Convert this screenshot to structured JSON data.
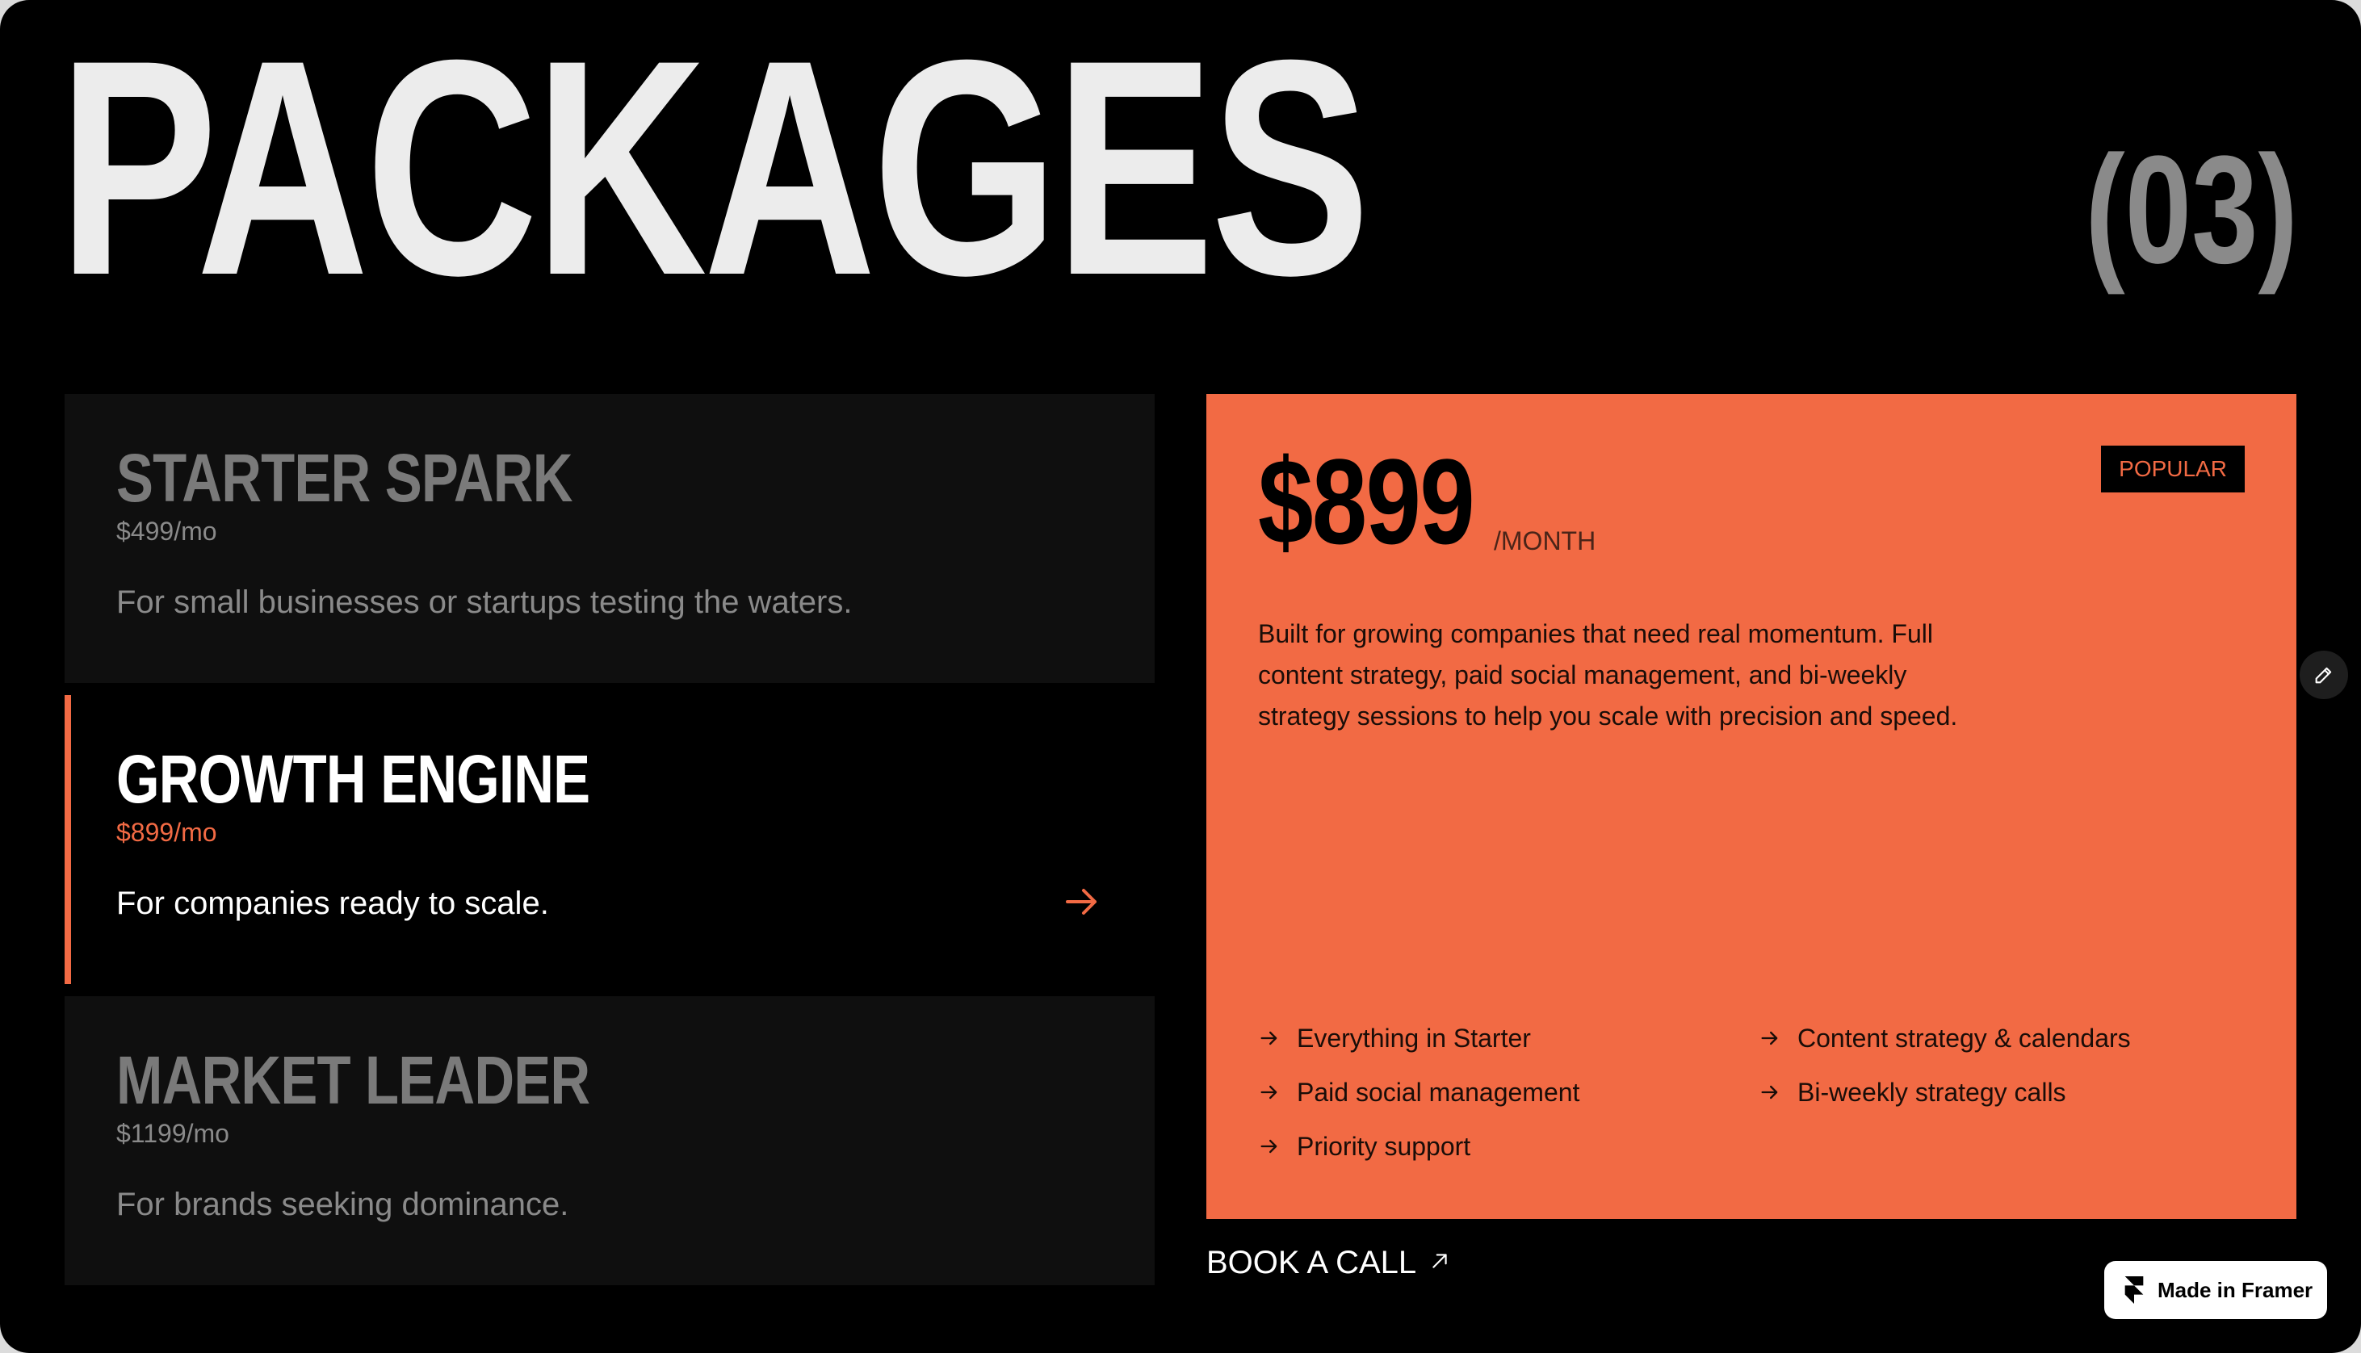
{
  "header": {
    "title": "PACKAGES",
    "section_number": "(03)"
  },
  "plans": [
    {
      "name": "STARTER SPARK",
      "price": "$499/mo",
      "description": "For small businesses or startups testing the waters.",
      "active": false
    },
    {
      "name": "GROWTH ENGINE",
      "price": "$899/mo",
      "description": "For companies ready to scale.",
      "active": true
    },
    {
      "name": "MARKET LEADER",
      "price": "$1199/mo",
      "description": "For brands seeking dominance.",
      "active": false
    }
  ],
  "detail": {
    "badge": "POPULAR",
    "price": "$899",
    "period": "/MONTH",
    "description": "Built for growing companies that need real momentum. Full content strategy, paid social management, and bi-weekly strategy sessions to help you scale with precision and speed.",
    "features": [
      "Everything in Starter",
      "Content strategy & calendars",
      "Paid social management",
      "Bi-weekly strategy calls",
      "Priority support"
    ]
  },
  "cta": {
    "label": "BOOK A CALL"
  },
  "framer_badge": {
    "label": "Made in Framer"
  },
  "colors": {
    "accent": "#f26a44",
    "background": "#000000",
    "inactive_card": "#0f0f0f",
    "headline": "#ececec",
    "muted": "#8a8a8a"
  },
  "icons": {
    "plan_arrow": "arrow-right-icon",
    "feature_bullet": "arrow-right-icon",
    "cta": "arrow-up-right-icon",
    "edit": "pencil-icon",
    "framer": "framer-logo-icon"
  }
}
